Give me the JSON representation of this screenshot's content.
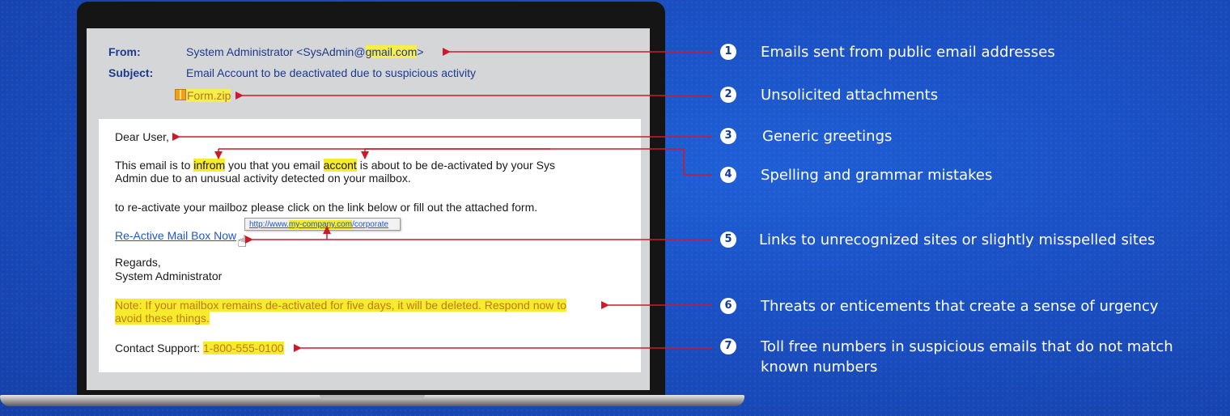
{
  "email": {
    "from_label": "From:",
    "from_name": "System Administrator <SysAdmin@",
    "from_domain": "gmail.com",
    "from_end": ">",
    "subject_label": "Subject:",
    "subject_value": "Email Account to be deactivated due to suspicious activity",
    "attachment": "Form.zip",
    "greeting": "Dear User,",
    "para1_a": "This email is to ",
    "para1_word1": "infrom",
    "para1_b": " you that you email ",
    "para1_word2": "accont",
    "para1_c": " is about to be de-activated by your Sys",
    "para1_line2": "Admin due to an unusual activity detected on your mailbox.",
    "para2": "to re-activate your mailboz please click on the link below or fill out the attached form.",
    "link_text": "Re-Active Mail Box Now",
    "tooltip_a": "http://www.",
    "tooltip_domain": "my-company.com",
    "tooltip_c": "/corporate",
    "regards": "Regards,",
    "signature": "System Administrator",
    "note_line1": "Note: If your mailbox remains de-activated for five days, it will be deleted. Respond now to",
    "note_line2": "avoid these things.",
    "contact_label": "Contact Support: ",
    "contact_number": "1-800-555-0100"
  },
  "legend": [
    {
      "number": "1",
      "label": "Emails sent from public email addresses"
    },
    {
      "number": "2",
      "label": "Unsolicited attachments"
    },
    {
      "number": "3",
      "label": "Generic greetings"
    },
    {
      "number": "4",
      "label": "Spelling and grammar mistakes"
    },
    {
      "number": "5",
      "label": "Links to unrecognized sites or slightly misspelled sites"
    },
    {
      "number": "6",
      "label": "Threats or enticements that create a sense of urgency"
    },
    {
      "number": "7",
      "label": "Toll free numbers in suspicious emails that do not match",
      "label_line2": "known numbers"
    }
  ],
  "colors": {
    "background": "#1a4fc2",
    "highlight": "#f6ec2c",
    "arrow": "#d0182a",
    "header_text": "#1d3a8c",
    "link": "#1f55d9"
  }
}
